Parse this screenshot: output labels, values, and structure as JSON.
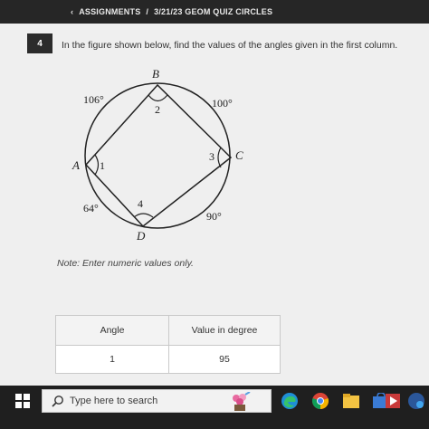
{
  "topbar": {
    "back_label": "ASSIGNMENTS",
    "separator": "/",
    "assignment_title": "3/21/23 GEOM QUIZ CIRCLES"
  },
  "question": {
    "number": "4",
    "prompt": "In the figure shown below, find the values of the angles given in the first column.",
    "note": "Note: Enter numeric values only."
  },
  "figure": {
    "points": {
      "B": "B",
      "A": "A",
      "C": "C",
      "D": "D"
    },
    "arcs": {
      "AB": "106°",
      "BC": "100°",
      "CD": "90°",
      "DA": "64°"
    },
    "angle_marks": {
      "at_B": "2",
      "at_A": "1",
      "at_C": "3",
      "at_D": "4"
    }
  },
  "table": {
    "headers": [
      "Angle",
      "Value in degree"
    ],
    "rows": [
      {
        "angle": "1",
        "value": "95"
      }
    ]
  },
  "taskbar": {
    "search_placeholder": "Type here to search",
    "icons": [
      "windows-start-icon",
      "search-icon",
      "flower-app-icon",
      "edge-browser-icon",
      "chrome-browser-icon",
      "file-explorer-icon",
      "store-icon",
      "media-icon",
      "word-icon"
    ]
  }
}
